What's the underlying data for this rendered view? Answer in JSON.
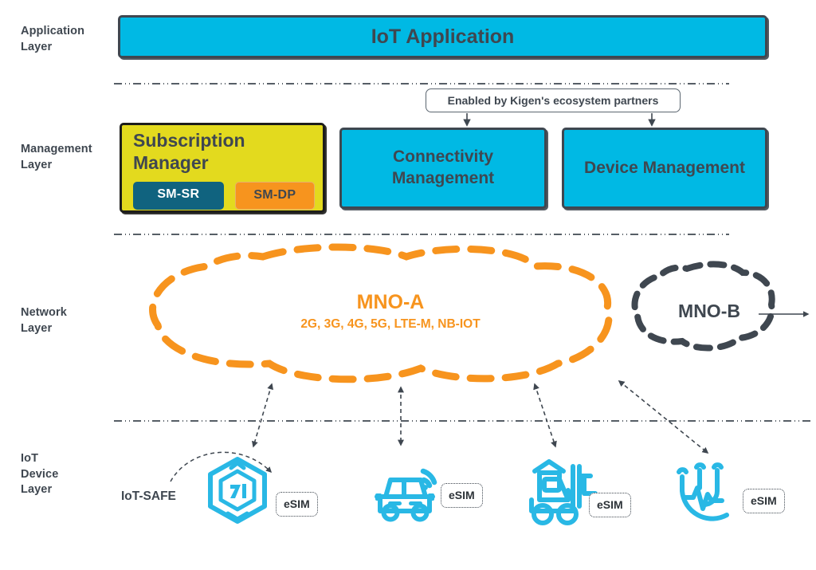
{
  "diagram": {
    "title": "IoT eSIM architecture layers",
    "colors": {
      "cyan": "#00b9e4",
      "yellow": "#e3da1e",
      "orange": "#f7941e",
      "teal": "#10637f",
      "dark": "#3f4750"
    }
  },
  "layers": [
    {
      "id": "application",
      "label": "Application\nLayer"
    },
    {
      "id": "management",
      "label": "Management\nLayer"
    },
    {
      "id": "network",
      "label": "Network\nLayer"
    },
    {
      "id": "device",
      "label": "IoT\nDevice\nLayer"
    }
  ],
  "application_layer": {
    "box_label": "IoT Application"
  },
  "management_layer": {
    "partner_note": "Enabled by Kigen's ecosystem partners",
    "subscription_manager": {
      "title": "Subscription Manager",
      "chips": [
        {
          "id": "sm-sr",
          "label": "SM-SR"
        },
        {
          "id": "sm-dp",
          "label": "SM-DP"
        }
      ]
    },
    "boxes": [
      {
        "id": "connectivity-management",
        "label": "Connectivity\nManagement"
      },
      {
        "id": "device-management",
        "label": "Device\nManagement"
      }
    ]
  },
  "network_layer": {
    "mno_a": {
      "name": "MNO-A",
      "technologies": "2G, 3G, 4G, 5G, LTE-M, NB-IOT"
    },
    "mno_b": {
      "name": "MNO-B"
    }
  },
  "device_layer": {
    "iot_safe_label": "IoT-SAFE",
    "esim_label": "eSIM",
    "devices": [
      {
        "id": "secure-element",
        "icon": "hexagon-shield-kigen-icon",
        "esim": "eSIM"
      },
      {
        "id": "connected-car",
        "icon": "connected-car-icon",
        "esim": "eSIM"
      },
      {
        "id": "forklift",
        "icon": "forklift-icon",
        "esim": "eSIM"
      },
      {
        "id": "medical-monitor",
        "icon": "stethoscope-heartbeat-icon",
        "esim": "eSIM"
      }
    ]
  }
}
